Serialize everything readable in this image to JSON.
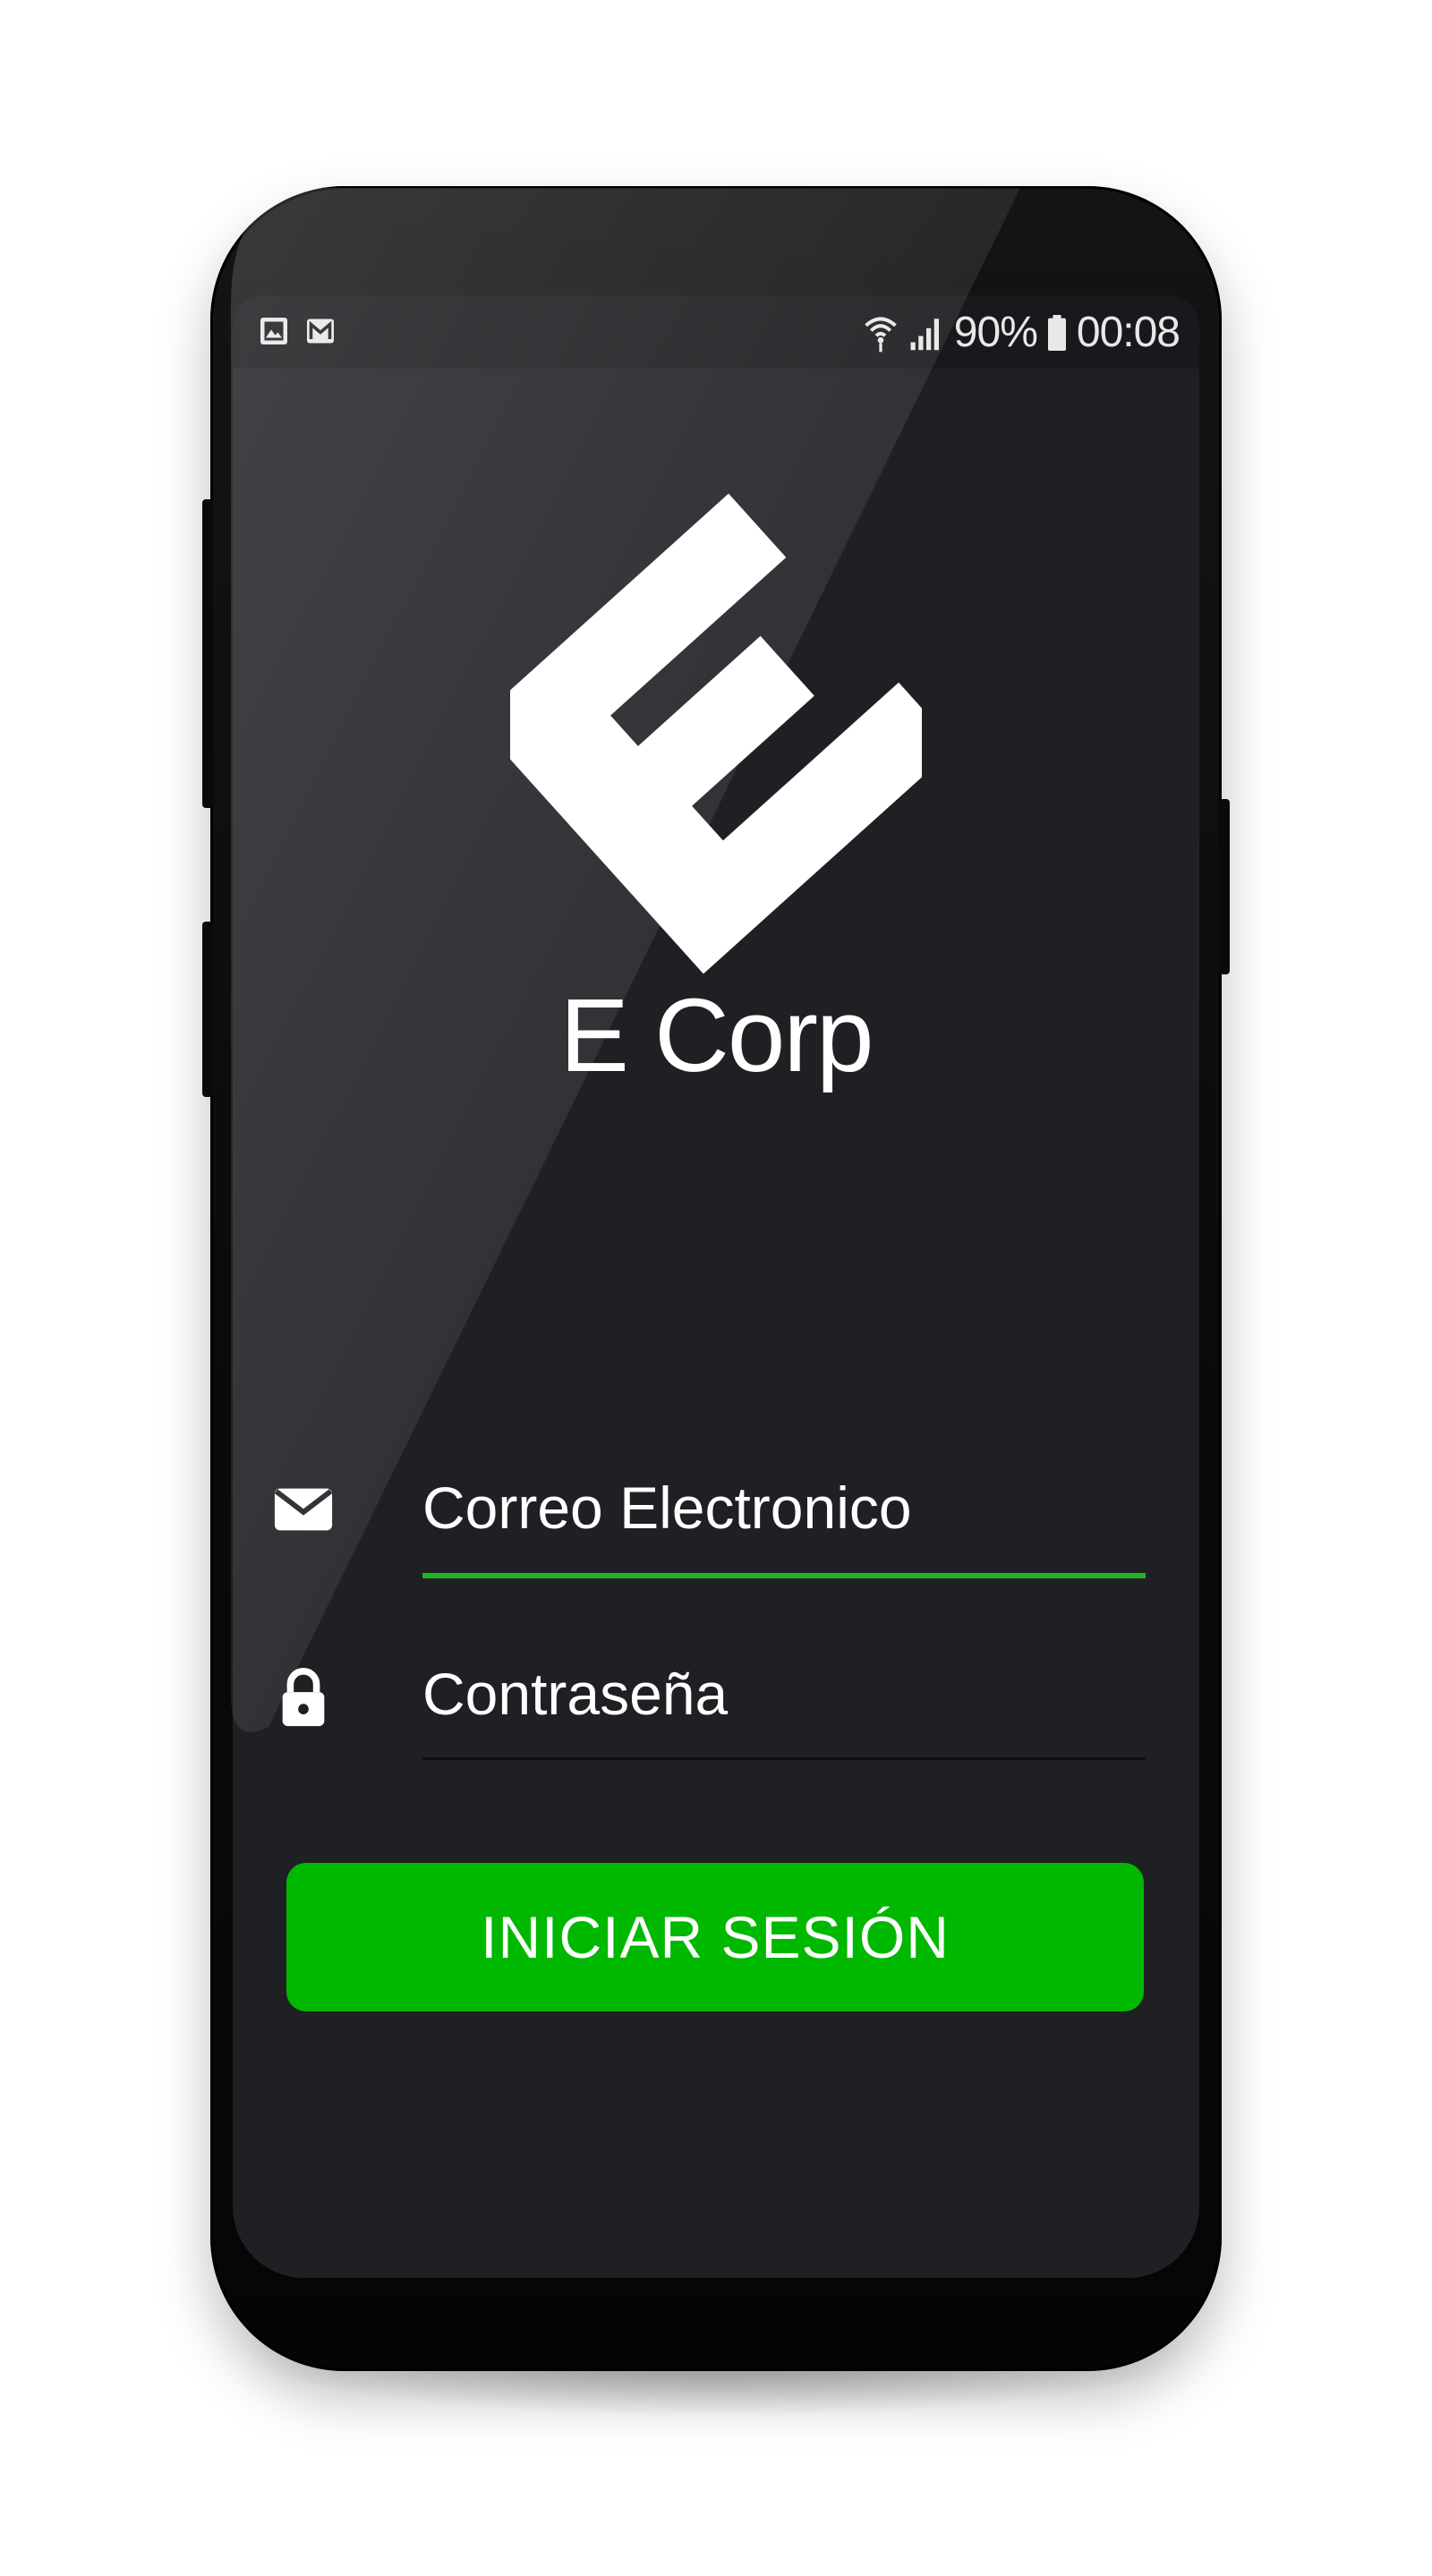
{
  "status_bar": {
    "left_icons": [
      "gallery-icon",
      "gmail-icon"
    ],
    "right_icons": [
      "wifi-icon",
      "signal-icon",
      "battery-icon"
    ],
    "battery_text": "90%",
    "time": "00:08"
  },
  "brand": {
    "logo_icon": "e-corp-logo-icon",
    "title": "E Corp"
  },
  "form": {
    "email": {
      "icon": "mail-icon",
      "placeholder": "Correo Electronico",
      "value": ""
    },
    "password": {
      "icon": "lock-icon",
      "placeholder": "Contraseña",
      "value": ""
    },
    "submit_label": "INICIAR SESIÓN"
  },
  "colors": {
    "accent": "#00b800",
    "screen_bg": "#1f2024",
    "text": "#ffffff",
    "focused_underline": "#1fb41f",
    "idle_underline": "#0e0e10"
  }
}
